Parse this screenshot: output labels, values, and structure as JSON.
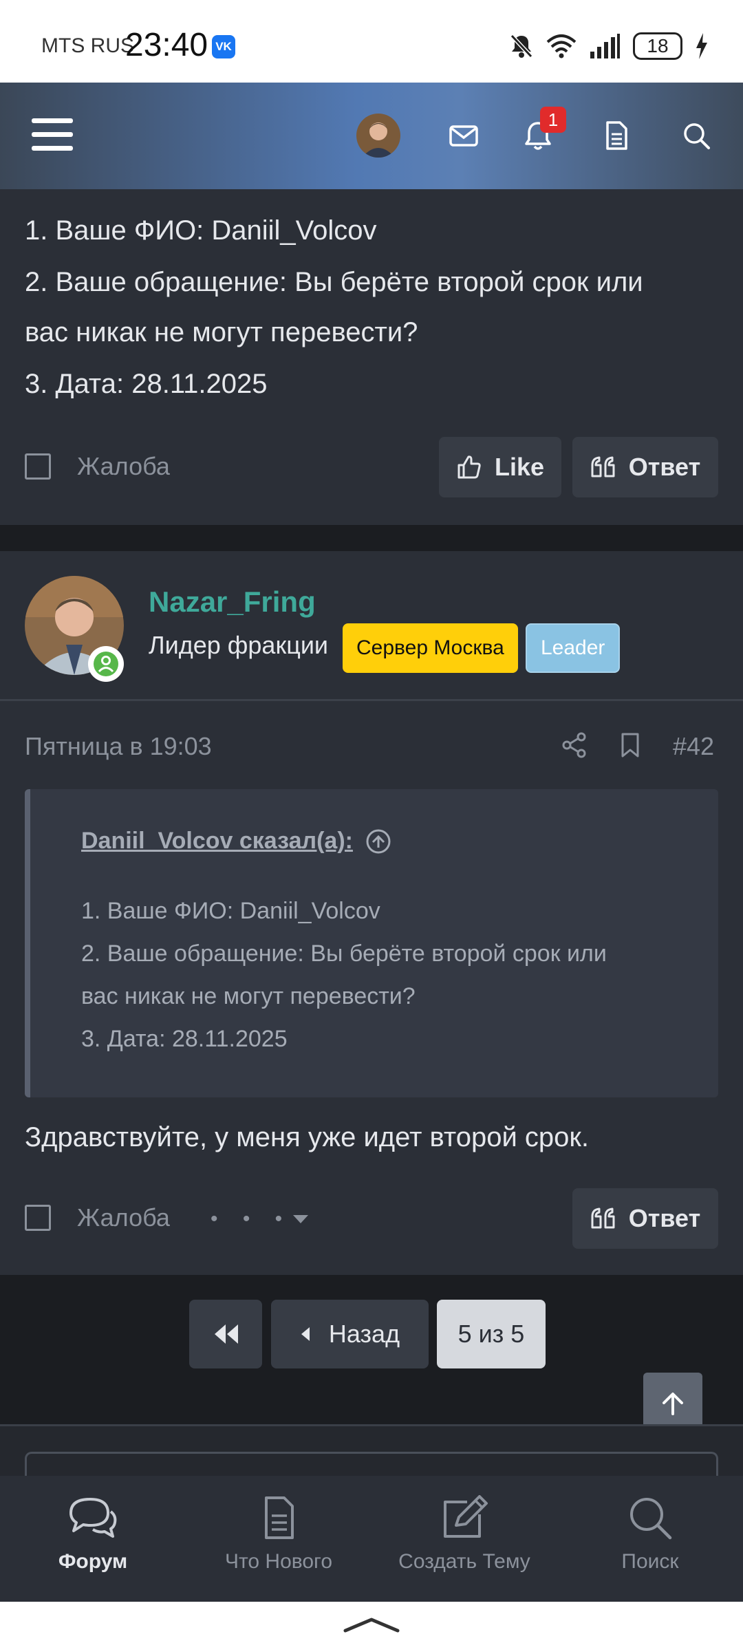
{
  "status_bar": {
    "carrier": "MTS RUS",
    "time": "23:40",
    "app_badge": "VK",
    "battery": "18"
  },
  "header": {
    "notification_count": "1",
    "icons": [
      "menu-icon",
      "avatar",
      "mail-icon",
      "bell-icon",
      "document-icon",
      "search-icon"
    ]
  },
  "post1": {
    "lines": [
      "1. Ваше ФИО: Daniil_Volcov",
      "2. Ваше обращение: Вы берёте второй срок или",
      "вас никак не могут перевести?",
      "3. Дата: 28.11.2025"
    ],
    "report_label": "Жалоба",
    "like_label": "Like",
    "reply_label": "Ответ"
  },
  "post2": {
    "author": "Nazar_Fring",
    "author_title": "Лидер фракции",
    "badges": [
      "Сервер Москва",
      "Leader"
    ],
    "date": "Пятница в 19:03",
    "post_number": "#42",
    "quote": {
      "author_line": "Daniil_Volcov сказал(а):",
      "lines": [
        "1. Ваше ФИО: Daniil_Volcov",
        "2. Ваше обращение: Вы берёте второй срок или",
        "вас никак не могут перевести?",
        "3. Дата: 28.11.2025"
      ]
    },
    "body": "Здравствуйте, у меня уже идет второй срок.",
    "report_label": "Жалоба",
    "reply_label": "Ответ"
  },
  "pagination": {
    "back_label": "Назад",
    "current": "5 из 5"
  },
  "bottom_nav": {
    "items": [
      {
        "label": "Форум",
        "icon": "forum-icon",
        "active": true
      },
      {
        "label": "Что Нового",
        "icon": "whats-new-icon",
        "active": false
      },
      {
        "label": "Создать Тему",
        "icon": "create-topic-icon",
        "active": false
      },
      {
        "label": "Поиск",
        "icon": "search-icon",
        "active": false
      }
    ]
  },
  "colors": {
    "accent_name": "#3fa99a",
    "badge_server": "#ffcf0a",
    "badge_leader": "#8ac3e3",
    "notification": "#e12b2b"
  }
}
